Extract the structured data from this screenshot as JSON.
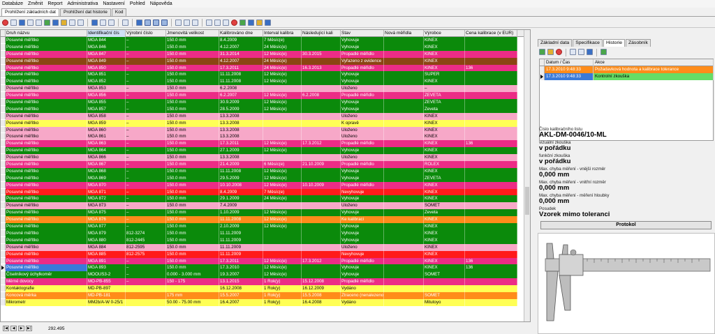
{
  "menu": [
    "Databáze",
    "Změnit",
    "Report",
    "Administrativa",
    "Nastavení",
    "Pohled",
    "Nápověda"
  ],
  "doc_tabs": [
    "Prohlížení základních dat",
    "Prohlížení dat historie",
    "Kod"
  ],
  "grid": {
    "columns": [
      "Druh názvu",
      "Identifikační čís",
      "Výrobní číslo",
      "Jmenovitá velikost",
      "Kalibrováno dne",
      "Interval kalibra",
      "Následující kali",
      "Stav",
      "Nová měřidla",
      "Výrobce",
      "Cena kalibrace (v EUR)"
    ],
    "sorted_column": "Identifikační čís",
    "rows": [
      {
        "c": [
          "Posuvné měřítko",
          "MGA 844",
          "–",
          "150.0 mm",
          "8.4.2009",
          "7 Měsíc(e)",
          "",
          "Vyhovuje",
          "",
          "KINEX",
          ""
        ],
        "bg": "#0b8a0b",
        "fg": "#ffffff"
      },
      {
        "c": [
          "Posuvné měřítko",
          "MGA 846",
          "–",
          "150.0 mm",
          "4.12.2007",
          "24 Měsíc(e)",
          "",
          "Vyhovuje",
          "",
          "KINEX",
          ""
        ],
        "bg": "#0b8a0b",
        "fg": "#ffffff"
      },
      {
        "c": [
          "Posuvné měřítko",
          "MGA 847",
          "–",
          "150.0 mm",
          "31.3.2014",
          "12 Měsíc(e)",
          "30.3.2015",
          "Propadlé měřidlo",
          "",
          "KINEX",
          ""
        ],
        "bg": "#ec2c86",
        "fg": "#ffffff"
      },
      {
        "c": [
          "Posuvné měřítko",
          "MGA 849",
          "–",
          "150.0 mm",
          "4.12.2007",
          "24 Měsíc(e)",
          "",
          "Vyřazeno z evidence",
          "",
          "KINEX",
          ""
        ],
        "bg": "#8b4513",
        "fg": "#ffffff"
      },
      {
        "c": [
          "Posuvné měřítko",
          "MGA 850",
          "–",
          "150.0 mm",
          "17.3.2011",
          "24 Měsíc(e)",
          "16.3.2013",
          "Propadlé měřidlo",
          "",
          "KINEX",
          "136"
        ],
        "bg": "#ec2c86",
        "fg": "#ffffff"
      },
      {
        "c": [
          "Posuvné měřítko",
          "MGA 851",
          "–",
          "150.0 mm",
          "11.11.2008",
          "12 Měsíc(e)",
          "",
          "Vyhovuje",
          "",
          "SUPER",
          ""
        ],
        "bg": "#0b8a0b",
        "fg": "#ffffff"
      },
      {
        "c": [
          "Posuvné měřítko",
          "MGA 852",
          "–",
          "150.0 mm",
          "11.11.2008",
          "12 Měsíc(e)",
          "",
          "Vyhovuje",
          "",
          "KINEX",
          ""
        ],
        "bg": "#0b8a0b",
        "fg": "#ffffff"
      },
      {
        "c": [
          "Posuvné měřítko",
          "MGA 853",
          "–",
          "150.0 mm",
          "6.2.2008",
          "",
          "",
          "Uloženo",
          "",
          "–",
          ""
        ],
        "bg": "#f7a8c8",
        "fg": "#000000"
      },
      {
        "c": [
          "Posuvné měřítko",
          "MGA 856",
          "–",
          "150.0 mm",
          "6.2.2007",
          "12 Měsíc(e)",
          "6.2.2008",
          "Propadlé měřidlo",
          "",
          "ZEVETA",
          ""
        ],
        "bg": "#ec2c86",
        "fg": "#ffffff"
      },
      {
        "c": [
          "Posuvné měřítko",
          "MGA 855",
          "–",
          "150.0 mm",
          "30.9.2009",
          "12 Měsíc(e)",
          "",
          "Vyhovuje",
          "",
          "ZEVETA",
          ""
        ],
        "bg": "#0b8a0b",
        "fg": "#ffffff"
      },
      {
        "c": [
          "Posuvné měřítko",
          "MGA 857",
          "–",
          "150.0 mm",
          "28.5.2009",
          "12 Měsíc(e)",
          "",
          "Vyhovuje",
          "",
          "Zeveta",
          ""
        ],
        "bg": "#0b8a0b",
        "fg": "#ffffff"
      },
      {
        "c": [
          "Posuvné měřítko",
          "MGA 858",
          "–",
          "150.0 mm",
          "13.3.2008",
          "",
          "",
          "Uloženo",
          "",
          "KINEX",
          ""
        ],
        "bg": "#f7a8c8",
        "fg": "#000000"
      },
      {
        "c": [
          "Posuvné měřítko",
          "MGA 859",
          "–",
          "150.0 mm",
          "13.3.2008",
          "",
          "",
          "K opravě",
          "",
          "KINEX",
          ""
        ],
        "bg": "#ffff55",
        "fg": "#000000"
      },
      {
        "c": [
          "Posuvné měřítko",
          "MGA 860",
          "–",
          "150.0 mm",
          "13.3.2008",
          "",
          "",
          "Uloženo",
          "",
          "KINEX",
          ""
        ],
        "bg": "#f7a8c8",
        "fg": "#000000"
      },
      {
        "c": [
          "Posuvné měřítko",
          "MGA 861",
          "–",
          "150.0 mm",
          "13.3.2008",
          "",
          "",
          "Uloženo",
          "",
          "KINEX",
          ""
        ],
        "bg": "#f7a8c8",
        "fg": "#000000"
      },
      {
        "c": [
          "Posuvné měřítko",
          "MGA 863",
          "–",
          "150.0 mm",
          "17.3.2011",
          "12 Měsíc(e)",
          "17.3.2012",
          "Propadlé měřidlo",
          "",
          "KINEX",
          "136"
        ],
        "bg": "#ec2c86",
        "fg": "#ffffff"
      },
      {
        "c": [
          "Posuvné měřítko",
          "MGA 864",
          "–",
          "150.0 mm",
          "27.1.2009",
          "12 Měsíc(e)",
          "",
          "Vyhovuje",
          "",
          "KINEX",
          ""
        ],
        "bg": "#0b8a0b",
        "fg": "#ffffff"
      },
      {
        "c": [
          "Posuvné měřítko",
          "MGA 866",
          "–",
          "150.0 mm",
          "13.3.2008",
          "",
          "",
          "Uloženo",
          "",
          "KINEX",
          ""
        ],
        "bg": "#f7a8c8",
        "fg": "#000000"
      },
      {
        "c": [
          "Posuvné měřítko",
          "MGA 867",
          "–",
          "150.0 mm",
          "21.4.2009",
          "6 Měsíc(e)",
          "21.10.2009",
          "Propadlé měřidlo",
          "",
          "ROLEX",
          ""
        ],
        "bg": "#ec2c86",
        "fg": "#ffffff"
      },
      {
        "c": [
          "Posuvné měřítko",
          "MGA 868",
          "–",
          "150.0 mm",
          "11.11.2008",
          "12 Měsíc(e)",
          "",
          "Vyhovuje",
          "",
          "KINEX",
          ""
        ],
        "bg": "#0b8a0b",
        "fg": "#ffffff"
      },
      {
        "c": [
          "Posuvné měřítko",
          "MGA 869",
          "–",
          "150.0 mm",
          "29.5.2009",
          "12 Měsíc(e)",
          "",
          "Vyhovuje",
          "",
          "ZEVETA",
          ""
        ],
        "bg": "#0b8a0b",
        "fg": "#ffffff"
      },
      {
        "c": [
          "Posuvné měřítko",
          "MGA 870",
          "–",
          "150.0 mm",
          "10.10.2008",
          "12 Měsíc(e)",
          "10.10.2009",
          "Propadlé měřidlo",
          "",
          "KINEX",
          ""
        ],
        "bg": "#ec2c86",
        "fg": "#ffffff"
      },
      {
        "c": [
          "Posuvné měřítko",
          "MGA 871",
          "–",
          "150.0 mm",
          "8.4.2009",
          "7 Měsíc(e)",
          "",
          "Nevyhovuje",
          "",
          "KINEX",
          ""
        ],
        "bg": "#ff1a1a",
        "fg": "#ffffff"
      },
      {
        "c": [
          "Posuvné měřítko",
          "MGA 872",
          "–",
          "150.0 mm",
          "29.1.2009",
          "24 Měsíc(e)",
          "",
          "Vyhovuje",
          "",
          "KINEX",
          ""
        ],
        "bg": "#0b8a0b",
        "fg": "#ffffff"
      },
      {
        "c": [
          "Posuvné měřítko",
          "MGA 873",
          "–",
          "150.0 mm",
          "7.4.2009",
          "",
          "",
          "Uloženo",
          "",
          "SOMET",
          ""
        ],
        "bg": "#f7a8c8",
        "fg": "#000000"
      },
      {
        "c": [
          "Posuvné měřítko",
          "MGA 875",
          "–",
          "150.0 mm",
          "1.10.2009",
          "12 Měsíc(e)",
          "",
          "Vyhovuje",
          "",
          "Zeveta",
          ""
        ],
        "bg": "#0b8a0b",
        "fg": "#ffffff"
      },
      {
        "c": [
          "Posuvné měřítko",
          "MGA 876",
          "–",
          "150.0 mm",
          "11.11.2008",
          "12 Měsíc(e)",
          "",
          "Ke kalibraci",
          "",
          "KINEX",
          ""
        ],
        "bg": "#ff8c1a",
        "fg": "#ffffff"
      },
      {
        "c": [
          "Posuvné měřítko",
          "MGA 877",
          "–",
          "150.0 mm",
          "2.10.2009",
          "12 Měsíc(e)",
          "",
          "Vyhovuje",
          "",
          "KINEX",
          ""
        ],
        "bg": "#0b8a0b",
        "fg": "#ffffff"
      },
      {
        "c": [
          "Posuvné měřítko",
          "MGA 879",
          "812-3274",
          "150.0 mm",
          "11.11.2009",
          "",
          "",
          "Vyhovuje",
          "",
          "KINEX",
          ""
        ],
        "bg": "#0b8a0b",
        "fg": "#ffffff"
      },
      {
        "c": [
          "Posuvné měřítko",
          "MGA 880",
          "812-2445",
          "150.0 mm",
          "11.11.2009",
          "",
          "",
          "Vyhovuje",
          "",
          "KINEX",
          ""
        ],
        "bg": "#0b8a0b",
        "fg": "#ffffff"
      },
      {
        "c": [
          "Posuvné měřítko",
          "MGA 884",
          "812-2595",
          "150.0 mm",
          "11.11.2009",
          "",
          "",
          "Uloženo",
          "",
          "KINEX",
          ""
        ],
        "bg": "#f7a8c8",
        "fg": "#000000"
      },
      {
        "c": [
          "Posuvné měřítko",
          "MGA 885",
          "812-2575",
          "150.0 mm",
          "11.11.2009",
          "",
          "",
          "Nevyhovuje",
          "",
          "KINEX",
          ""
        ],
        "bg": "#ff1a1a",
        "fg": "#ffffff"
      },
      {
        "c": [
          "Posuvné měřítko",
          "MGA 891",
          "–",
          "150.0 mm",
          "17.3.2011",
          "12 Měsíc(e)",
          "17.3.2012",
          "Propadlé měřidlo",
          "",
          "KINEX",
          "136"
        ],
        "bg": "#ec2c86",
        "fg": "#ffffff"
      },
      {
        "c": [
          "Posuvné měřítko",
          "MGA 893",
          "–",
          "150.0 mm",
          "17.3.2010",
          "12 Měsíc(e)",
          "",
          "Vyhovuje",
          "",
          "KINEX",
          "136"
        ],
        "bg": "#0b8a0b",
        "fg": "#ffffff",
        "selected": true
      },
      {
        "c": [
          "Číselníkový úchylkoměr",
          "MOOUS3-2",
          "–",
          "0.000 - 3.000 mm",
          "19.3.2007",
          "12 Měsíc(e)",
          "",
          "Vyhovuje",
          "",
          "SOMET",
          ""
        ],
        "bg": "#0b8a0b",
        "fg": "#ffffff"
      },
      {
        "c": [
          "Měrné dovocy",
          "MO-PB-855",
          "–",
          "150 - 175",
          "13.1.2015",
          "1 Rok(y)",
          "15.12.2008",
          "Propadlé měřidlo",
          "",
          "",
          ""
        ],
        "bg": "#ec2c86",
        "fg": "#ffffff"
      },
      {
        "c": [
          "Kontaktografie",
          "MD-PB-897",
          "",
          "",
          "16.12.2008",
          "1 Rok(y)",
          "16.12.2009",
          "Vydáno",
          "",
          "",
          ""
        ],
        "bg": "#ffff55",
        "fg": "#000000"
      },
      {
        "c": [
          "Koncová měrka",
          "MD-PB-181",
          "",
          "175 mm",
          "15.5.2007",
          "1 Rok(y)",
          "15.5.2008",
          "Ztraceno (nenalezeno)",
          "",
          "SOMET",
          ""
        ],
        "bg": "#ff8c1a",
        "fg": "#ffffff"
      },
      {
        "c": [
          "Mikrometr",
          "MM2b/A-W 0-25/1",
          "",
          "50.00 - 75.00 mm",
          "16.4.2007",
          "1 Rok(y)",
          "16.4.2008",
          "Vydáno",
          "",
          "Mitutoyo",
          ""
        ],
        "bg": "#ffff55",
        "fg": "#000000"
      }
    ]
  },
  "status": {
    "nav": [
      "|◀",
      "◀",
      "▶",
      "▶|"
    ],
    "record_count": "292.495"
  },
  "right_tabs": [
    "Základní data",
    "Specifikace",
    "Historie",
    "Zásobník"
  ],
  "right_active_tab": "Historie",
  "history": {
    "columns": [
      "Datum / Čas",
      "Akce"
    ],
    "rows": [
      {
        "date": "17.3.2010 9:48:33",
        "action": "Požadavková hodnota a kalibrace tolerance",
        "bg": "#ff8c1a",
        "fg": "#ffffff"
      },
      {
        "date": "17.3.2010 9:48:33",
        "action": "Kontrolní zkouška",
        "bg": "#66dd66",
        "fg": "#000000",
        "selected": true
      }
    ]
  },
  "detail": {
    "cert_label": "Číslo kalibračního listu",
    "cert_value": "AKL-DM-0046/10-ML",
    "visual_label": "vizuální zkouška",
    "visual_value": "v pořádku",
    "func_label": "funkční zkouška",
    "func_value": "v pořádku",
    "ext_label": "Max. chyba měření - vnější rozměr",
    "ext_value": "0,000 mm",
    "int_label": "Max. chyba měření - vnitřní rozměr",
    "int_value": "0,000 mm",
    "depth_label": "Max. chyba měření - měření hloubky",
    "depth_value": "0,000 mm",
    "assess_label": "Posudek",
    "assess_value": "Vzorek mimo toleranci",
    "protokol_button": "Protokol"
  }
}
